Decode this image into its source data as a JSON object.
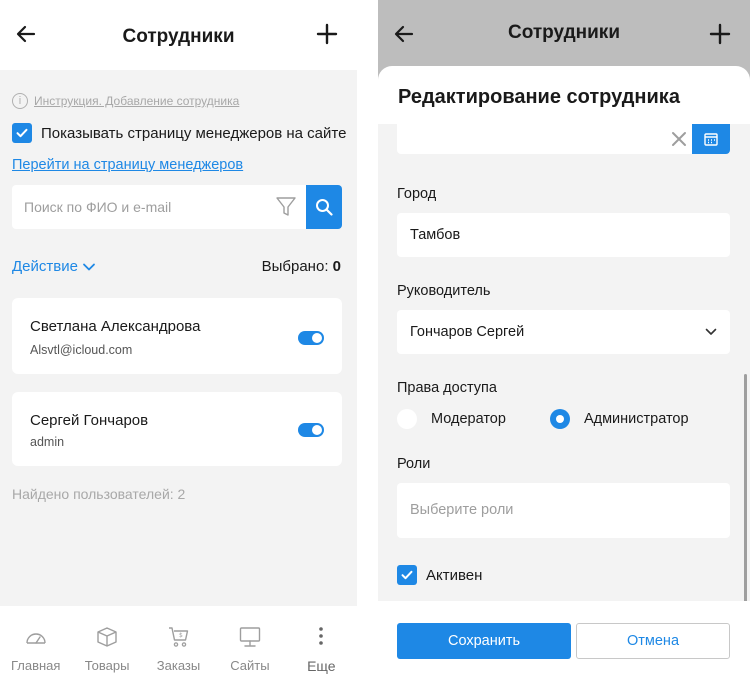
{
  "left": {
    "header": {
      "title": "Сотрудники"
    },
    "hint": {
      "icon": "info-icon",
      "text": "Инструкция. Добавление сотрудника"
    },
    "show_managers": {
      "label": "Показывать страницу менеджеров на сайте",
      "checked": true
    },
    "managers_link": "Перейти на страницу менеджеров",
    "search": {
      "placeholder": "Поиск по ФИО и e-mail"
    },
    "actions_label": "Действие",
    "selected": {
      "label": "Выбрано:",
      "count": "0"
    },
    "employees": [
      {
        "name": "Светлана Александрова",
        "email": "Alsvtl@icloud.com",
        "active": true
      },
      {
        "name": "Сергей Гончаров",
        "email": "admin",
        "active": true
      }
    ],
    "found": "Найдено пользователей: 2",
    "bottom_nav": [
      {
        "label": "Главная",
        "icon": "dashboard-icon"
      },
      {
        "label": "Товары",
        "icon": "box-icon"
      },
      {
        "label": "Заказы",
        "icon": "cart-icon"
      },
      {
        "label": "Сайты",
        "icon": "monitor-icon"
      },
      {
        "label": "Еще",
        "icon": "more-vertical-icon"
      }
    ]
  },
  "right": {
    "header": {
      "title": "Сотрудники"
    },
    "sheet_title": "Редактирование сотрудника",
    "city": {
      "label": "Город",
      "value": "Тамбов"
    },
    "manager": {
      "label": "Руководитель",
      "value": "Гончаров Сергей"
    },
    "access": {
      "label": "Права доступа",
      "options": [
        {
          "label": "Модератор",
          "selected": false
        },
        {
          "label": "Администратор",
          "selected": true
        }
      ]
    },
    "roles": {
      "label": "Роли",
      "placeholder": "Выберите роли"
    },
    "active": {
      "label": "Активен",
      "checked": true
    },
    "save_label": "Сохранить",
    "cancel_label": "Отмена",
    "colors": {
      "accent": "#1e88e5",
      "bg": "#f3f3f3",
      "overlay": "#bdbdbd"
    }
  }
}
